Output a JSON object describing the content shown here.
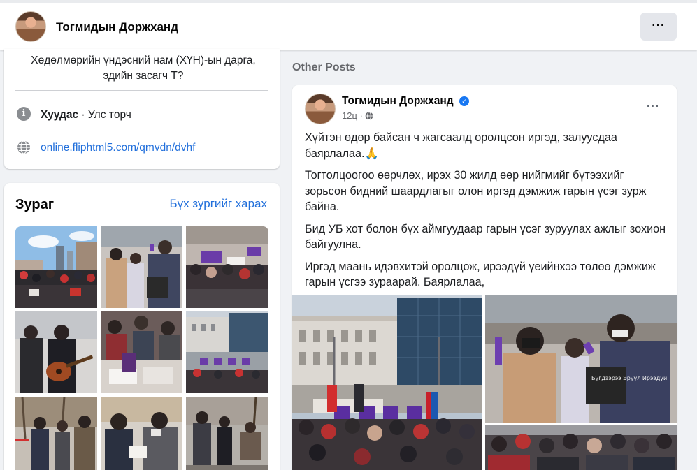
{
  "header": {
    "page_name": "Тогмидын Доржханд",
    "more_label": "···"
  },
  "intro": {
    "bio": "Хөдөлмөрийн үндэсний нам (ХҮН)-ын дарга, эдийн засагч Т?",
    "page_type_bold": "Хуудас",
    "page_type_rest": " · Улс төрч",
    "website": "online.fliphtml5.com/qmvdn/dvhf",
    "icons": [
      "info-icon",
      "globe-icon"
    ]
  },
  "photos": {
    "title": "Зураг",
    "see_all": "Бүх зургийг харах",
    "count_shown": 9
  },
  "section_label": "Other Posts",
  "post": {
    "author": "Тогмидын Доржханд",
    "verified": true,
    "time": "12ц ·",
    "more_label": "···",
    "paragraphs": [
      "Хүйтэн өдөр байсан ч жагсаалд оролцсон иргэд, залуусдаа баярлалаа.🙏",
      "Тогтолцоогоо өөрчлөх, ирэх 30 жилд өөр нийгмийг бүтээхийг зорьсон бидний шаардлагыг олон иргэд дэмжиж гарын үсэг зурж байна.",
      "Бид УБ хот болон бүх аймгуудаар гарын үсэг зуруулах ажлыг зохион байгуулна.",
      "Иргэд маань идэвхитэй оролцож, ирээдүй үеийнхээ төлөө дэмжиж гарын үсгээ зураарай. Баярлалаа,"
    ],
    "sign_text": "Бүгдээрээ Эрүүл Ирээдүй"
  },
  "colors": {
    "link": "#216fdb",
    "verified": "#1877f2",
    "background": "#f0f2f5"
  }
}
